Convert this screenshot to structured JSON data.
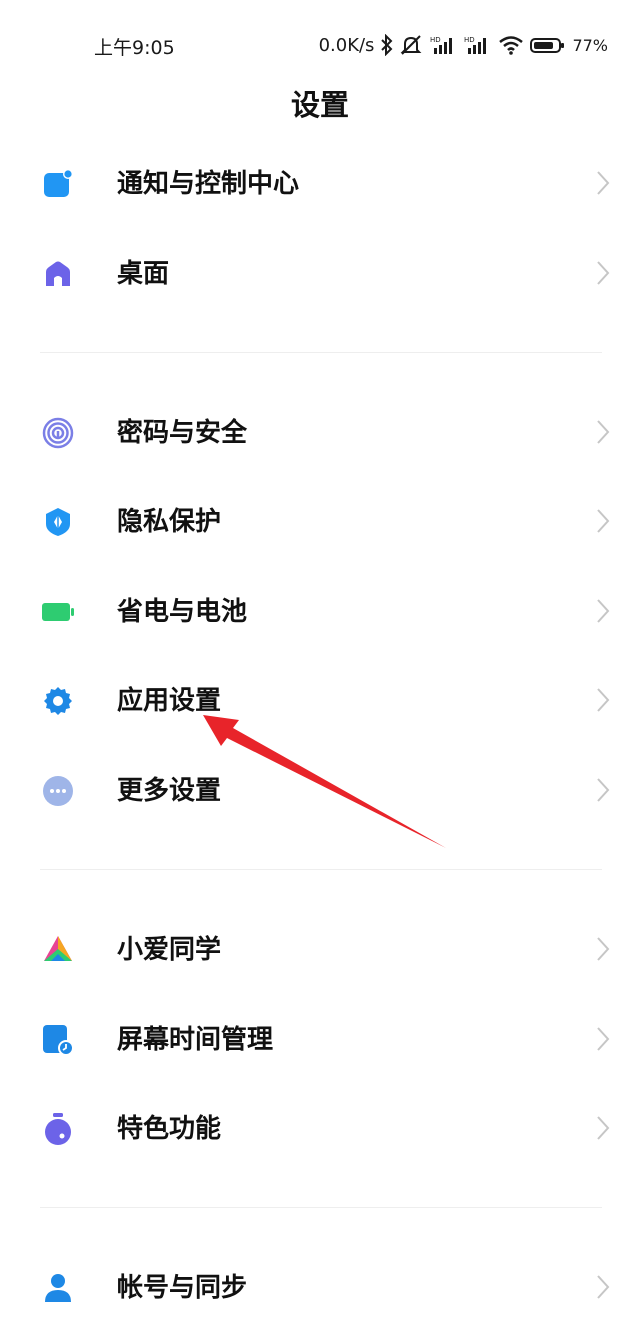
{
  "status_bar": {
    "time": "上午9:05",
    "net_speed": "0.0K/s",
    "battery": "77%",
    "icons": [
      "bluetooth-icon",
      "mute-icon",
      "signal-hd-icon",
      "signal-hd-icon",
      "wifi-icon",
      "battery-icon"
    ]
  },
  "title": "设置",
  "sections": [
    {
      "items": [
        {
          "label": "通知与控制中心",
          "icon": "notification-icon",
          "color": "#2196F3"
        },
        {
          "label": "桌面",
          "icon": "home-icon",
          "color": "#6C63E8"
        }
      ]
    },
    {
      "items": [
        {
          "label": "密码与安全",
          "icon": "fingerprint-icon",
          "color": "#7B7FE6"
        },
        {
          "label": "隐私保护",
          "icon": "shield-icon",
          "color": "#2196F3"
        },
        {
          "label": "省电与电池",
          "icon": "battery-icon",
          "color": "#2ECC71"
        },
        {
          "label": "应用设置",
          "icon": "gear-icon",
          "color": "#1E88E5"
        },
        {
          "label": "更多设置",
          "icon": "more-icon",
          "color": "#9FB5E8"
        }
      ]
    },
    {
      "items": [
        {
          "label": "小爱同学",
          "icon": "xiaoai-icon",
          "color": "#E84393"
        },
        {
          "label": "屏幕时间管理",
          "icon": "screen-time-icon",
          "color": "#1E88E5"
        },
        {
          "label": "特色功能",
          "icon": "feature-icon",
          "color": "#6C63E8"
        }
      ]
    },
    {
      "items": [
        {
          "label": "帐号与同步",
          "icon": "account-icon",
          "color": "#1E88E5"
        }
      ]
    }
  ],
  "annotation": {
    "color": "#E8242A"
  }
}
